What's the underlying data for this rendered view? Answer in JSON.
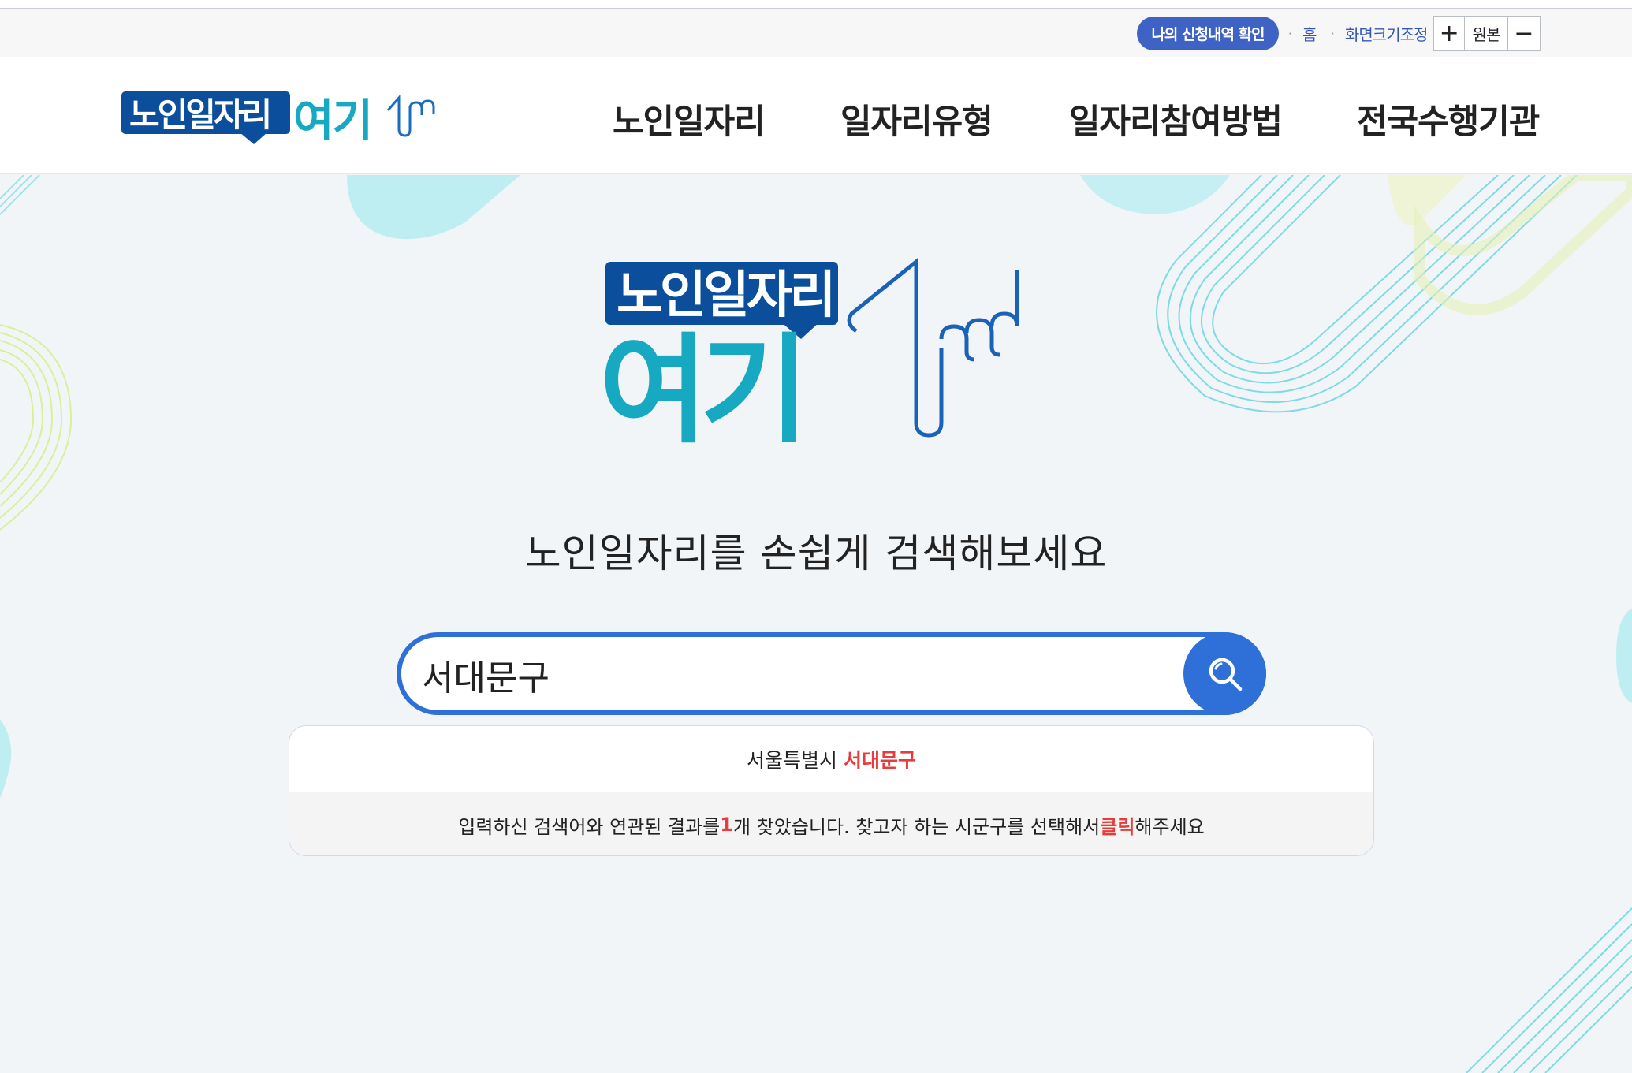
{
  "utility": {
    "apply_check": "나의 신청내역 확인",
    "home": "홈",
    "zoom_label": "화면크기조정",
    "zoom_in": "+",
    "zoom_reset": "원본",
    "zoom_out": "−"
  },
  "logo": {
    "line1": "노인일자리",
    "line2": "여기"
  },
  "nav": [
    "노인일자리",
    "일자리유형",
    "일자리참여방법",
    "전국수행기관"
  ],
  "hero": {
    "tagline": "노인일자리를 손쉽게 검색해보세요"
  },
  "search": {
    "value": "서대문구"
  },
  "results": {
    "items": [
      {
        "city": "서울특별시",
        "district": "서대문구"
      }
    ],
    "note_pre": "입력하신 검색어와 연관된 결과를 ",
    "count": "1",
    "note_mid": "개 찾았습니다. 찾고자 하는 시군구를 선택해서 ",
    "click": "클릭",
    "note_post": "해주세요"
  },
  "colors": {
    "brand_navy": "#0b4f9c",
    "brand_teal": "#18a9c2",
    "accent_blue": "#2f6fd8",
    "highlight_red": "#e83b3b"
  }
}
